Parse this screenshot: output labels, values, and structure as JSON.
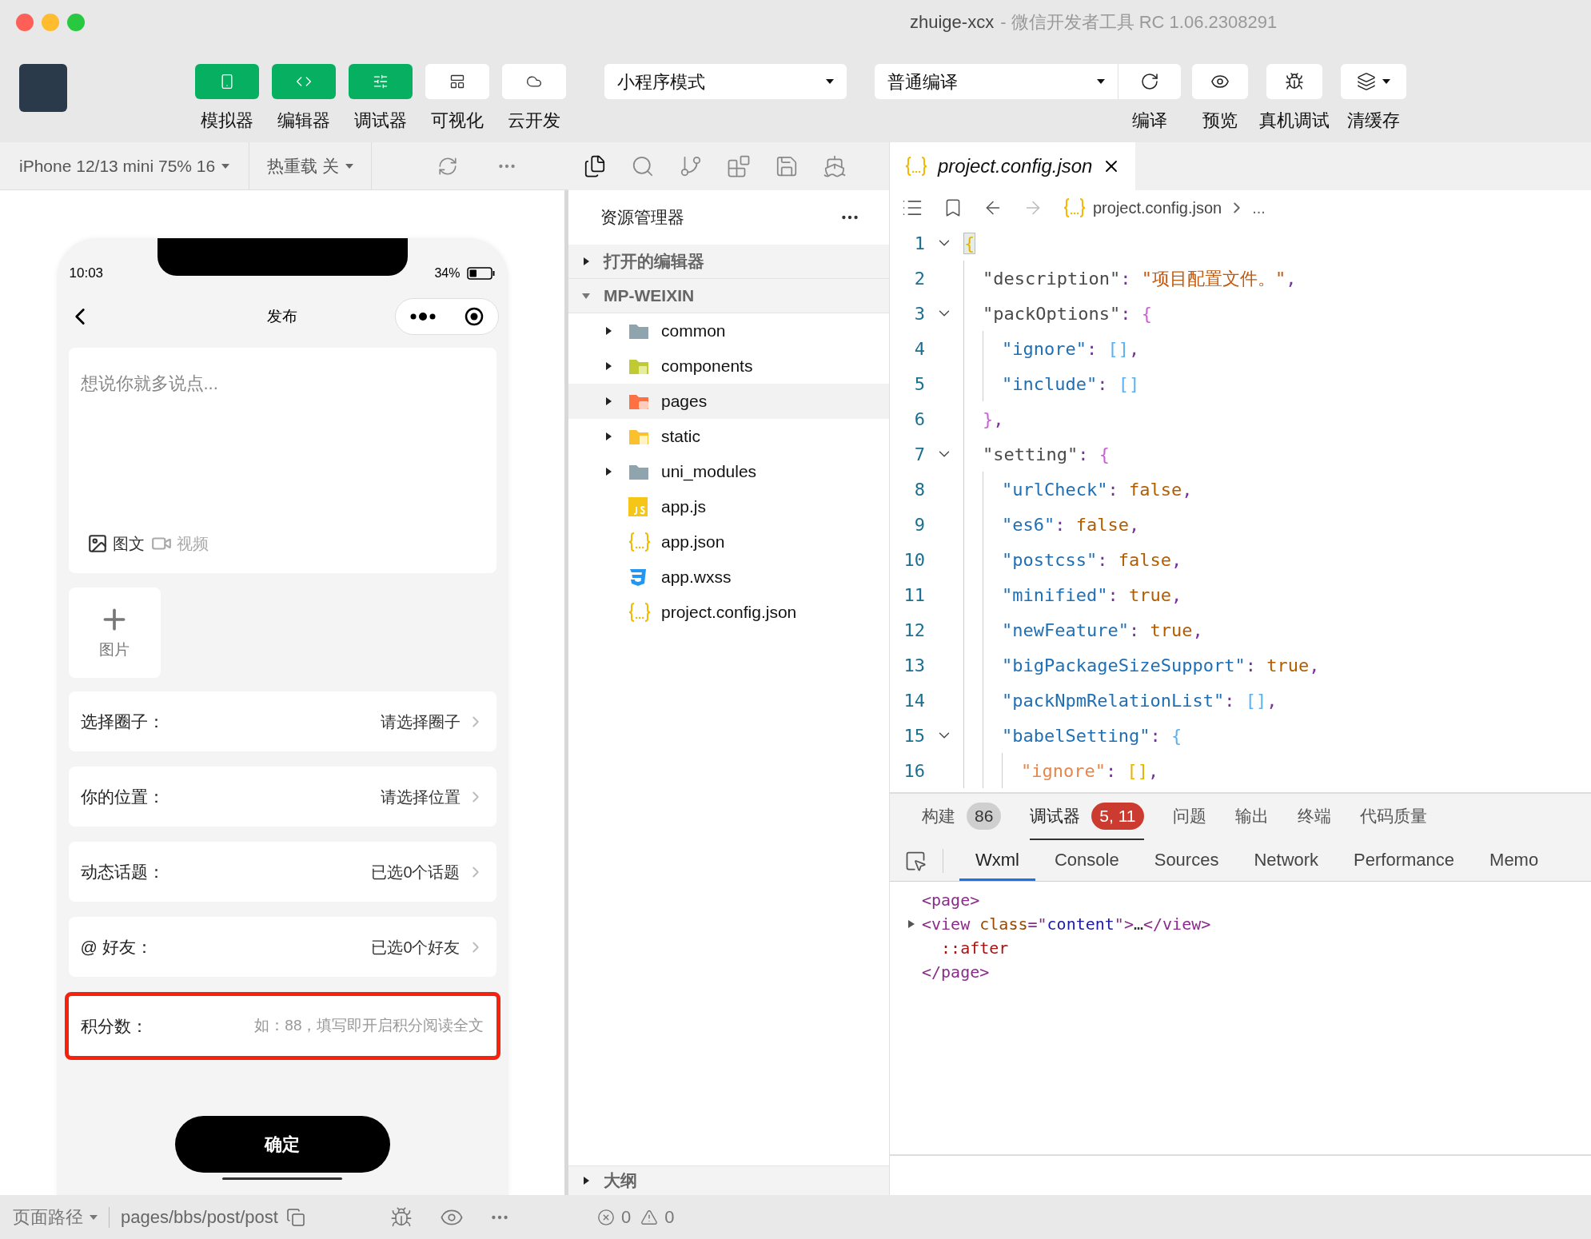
{
  "window": {
    "title": "zhuige-xcx",
    "subtitle": "- 微信开发者工具 RC 1.06.2308291"
  },
  "toolbar": {
    "view_toggles": [
      {
        "label": "模拟器",
        "kind": "phone",
        "on": true
      },
      {
        "label": "编辑器",
        "kind": "code",
        "on": true
      },
      {
        "label": "调试器",
        "kind": "sliders",
        "on": true
      },
      {
        "label": "可视化",
        "kind": "layout",
        "on": false
      },
      {
        "label": "云开发",
        "kind": "cloud",
        "on": false
      }
    ],
    "mode_select": "小程序模式",
    "compile_select": "普通编译",
    "actions": [
      {
        "label": "编译",
        "kind": "refresh"
      },
      {
        "label": "预览",
        "kind": "eye"
      },
      {
        "label": "真机调试",
        "kind": "bug"
      },
      {
        "label": "清缓存",
        "kind": "layers"
      }
    ]
  },
  "simulator": {
    "device": "iPhone 12/13 mini 75% 16",
    "hot_reload": "热重载 关",
    "phone": {
      "time": "10:03",
      "battery": {
        "text": "34%",
        "level": 0.34
      },
      "nav_title": "发布",
      "editor_placeholder": "想说你就多说点...",
      "media_types": [
        {
          "label": "图文",
          "kind": "image",
          "selected": true
        },
        {
          "label": "视频",
          "kind": "video",
          "selected": false
        }
      ],
      "add_image": "图片",
      "rows": [
        {
          "kind": "picker",
          "label": "选择圈子：",
          "value": "请选择圈子",
          "highlighted": false
        },
        {
          "kind": "picker",
          "label": "你的位置：",
          "value": "请选择位置",
          "highlighted": false
        },
        {
          "kind": "picker",
          "label": "动态话题：",
          "value": "已选0个话题",
          "highlighted": false
        },
        {
          "kind": "picker",
          "label": "@ 好友：",
          "value": "已选0个好友",
          "highlighted": false
        },
        {
          "kind": "input",
          "label": "积分数：",
          "placeholder": "如：88，填写即开启积分阅读全文",
          "highlighted": true
        }
      ],
      "submit": "确定"
    },
    "page_path": {
      "label": "页面路径",
      "path": "pages/bbs/post/post"
    }
  },
  "explorer": {
    "title": "资源管理器",
    "sections": [
      {
        "title": "打开的编辑器",
        "expanded": false
      },
      {
        "title": "MP-WEIXIN",
        "expanded": true,
        "children": [
          {
            "name": "common",
            "kind": "folder",
            "expanded": false,
            "selected": false
          },
          {
            "name": "components",
            "kind": "folder_components",
            "expanded": false,
            "selected": false
          },
          {
            "name": "pages",
            "kind": "folder_pages",
            "expanded": false,
            "selected": true
          },
          {
            "name": "static",
            "kind": "folder_static",
            "expanded": false,
            "selected": false
          },
          {
            "name": "uni_modules",
            "kind": "folder",
            "expanded": false,
            "selected": false
          },
          {
            "name": "app.js",
            "kind": "js",
            "selected": false
          },
          {
            "name": "app.json",
            "kind": "json",
            "selected": false
          },
          {
            "name": "app.wxss",
            "kind": "css",
            "selected": false
          },
          {
            "name": "project.config.json",
            "kind": "json",
            "selected": false
          }
        ]
      }
    ],
    "outline": {
      "title": "大纲",
      "expanded": false
    },
    "status": {
      "errors": "0",
      "warnings": "0"
    }
  },
  "editor": {
    "tab": "project.config.json",
    "breadcrumb": "project.config.json",
    "breadcrumb_more": "...",
    "lines": [
      {
        "number": "1",
        "fold": true,
        "tokens": [
          {
            "kind": "bracket3",
            "text": "{"
          }
        ]
      },
      {
        "number": "2",
        "fold": false,
        "tokens": [
          {
            "kind": "key1",
            "text": "\"description\""
          },
          {
            "kind": "punct",
            "text": ": "
          },
          {
            "kind": "string",
            "text": "\"项目配置文件。\""
          },
          {
            "kind": "punct",
            "text": ","
          }
        ]
      },
      {
        "number": "3",
        "fold": true,
        "tokens": [
          {
            "kind": "key1",
            "text": "\"packOptions\""
          },
          {
            "kind": "punct",
            "text": ": "
          },
          {
            "kind": "bracket1",
            "text": "{"
          }
        ]
      },
      {
        "number": "4",
        "fold": false,
        "tokens": [
          {
            "kind": "key2",
            "text": "\"ignore\""
          },
          {
            "kind": "punct",
            "text": ": "
          },
          {
            "kind": "bracket2",
            "text": "[]"
          },
          {
            "kind": "punct",
            "text": ","
          }
        ]
      },
      {
        "number": "5",
        "fold": false,
        "tokens": [
          {
            "kind": "key2",
            "text": "\"include\""
          },
          {
            "kind": "punct",
            "text": ": "
          },
          {
            "kind": "bracket2",
            "text": "[]"
          }
        ]
      },
      {
        "number": "6",
        "fold": false,
        "tokens": [
          {
            "kind": "bracket1",
            "text": "}"
          },
          {
            "kind": "punct",
            "text": ","
          }
        ]
      },
      {
        "number": "7",
        "fold": true,
        "tokens": [
          {
            "kind": "key1",
            "text": "\"setting\""
          },
          {
            "kind": "punct",
            "text": ": "
          },
          {
            "kind": "bracket1",
            "text": "{"
          }
        ]
      },
      {
        "number": "8",
        "fold": false,
        "tokens": [
          {
            "kind": "key2",
            "text": "\"urlCheck\""
          },
          {
            "kind": "punct",
            "text": ": "
          },
          {
            "kind": "literal",
            "text": "false"
          },
          {
            "kind": "punct",
            "text": ","
          }
        ]
      },
      {
        "number": "9",
        "fold": false,
        "tokens": [
          {
            "kind": "key2",
            "text": "\"es6\""
          },
          {
            "kind": "punct",
            "text": ": "
          },
          {
            "kind": "literal",
            "text": "false"
          },
          {
            "kind": "punct",
            "text": ","
          }
        ]
      },
      {
        "number": "10",
        "fold": false,
        "tokens": [
          {
            "kind": "key2",
            "text": "\"postcss\""
          },
          {
            "kind": "punct",
            "text": ": "
          },
          {
            "kind": "literal",
            "text": "false"
          },
          {
            "kind": "punct",
            "text": ","
          }
        ]
      },
      {
        "number": "11",
        "fold": false,
        "tokens": [
          {
            "kind": "key2",
            "text": "\"minified\""
          },
          {
            "kind": "punct",
            "text": ": "
          },
          {
            "kind": "literal",
            "text": "true"
          },
          {
            "kind": "punct",
            "text": ","
          }
        ]
      },
      {
        "number": "12",
        "fold": false,
        "tokens": [
          {
            "kind": "key2",
            "text": "\"newFeature\""
          },
          {
            "kind": "punct",
            "text": ": "
          },
          {
            "kind": "literal",
            "text": "true"
          },
          {
            "kind": "punct",
            "text": ","
          }
        ]
      },
      {
        "number": "13",
        "fold": false,
        "tokens": [
          {
            "kind": "key2",
            "text": "\"bigPackageSizeSupport\""
          },
          {
            "kind": "punct",
            "text": ": "
          },
          {
            "kind": "literal",
            "text": "true"
          },
          {
            "kind": "punct",
            "text": ","
          }
        ]
      },
      {
        "number": "14",
        "fold": false,
        "tokens": [
          {
            "kind": "key2",
            "text": "\"packNpmRelationList\""
          },
          {
            "kind": "punct",
            "text": ": "
          },
          {
            "kind": "bracket2",
            "text": "[]"
          },
          {
            "kind": "punct",
            "text": ","
          }
        ]
      },
      {
        "number": "15",
        "fold": true,
        "tokens": [
          {
            "kind": "key2",
            "text": "\"babelSetting\""
          },
          {
            "kind": "punct",
            "text": ": "
          },
          {
            "kind": "bracket2",
            "text": "{"
          }
        ]
      },
      {
        "number": "16",
        "fold": false,
        "tokens": [
          {
            "kind": "key3",
            "text": "\"ignore\""
          },
          {
            "kind": "punct",
            "text": ": "
          },
          {
            "kind": "bracket3",
            "text": "[]"
          },
          {
            "kind": "punct",
            "text": ","
          }
        ]
      }
    ]
  },
  "panel": {
    "tabs": [
      {
        "label": "构建",
        "badge": "86",
        "color": "#cfcfcf",
        "selected": false
      },
      {
        "label": "调试器",
        "badge": "5, 11",
        "color": "#cc3b30",
        "selected": true
      },
      {
        "label": "问题",
        "selected": false
      },
      {
        "label": "输出",
        "selected": false
      },
      {
        "label": "终端",
        "selected": false
      },
      {
        "label": "代码质量",
        "selected": false
      }
    ],
    "devtools_tabs": [
      {
        "label": "Wxml",
        "selected": true
      },
      {
        "label": "Console",
        "selected": false
      },
      {
        "label": "Sources",
        "selected": false
      },
      {
        "label": "Network",
        "selected": false
      },
      {
        "label": "Performance",
        "selected": false
      },
      {
        "label": "Memo",
        "selected": false
      }
    ],
    "wxml_lines": [
      {
        "expander": false,
        "tokens": [
          {
            "kind": "tag",
            "text": "<page>"
          }
        ]
      },
      {
        "expander": true,
        "tokens": [
          {
            "kind": "tag",
            "text": "<view"
          },
          {
            "kind": "attr",
            "text": " class"
          },
          {
            "kind": "tag",
            "text": "=\""
          },
          {
            "kind": "value",
            "text": "content"
          },
          {
            "kind": "tag",
            "text": "\">"
          },
          {
            "kind": "plain",
            "text": "…"
          },
          {
            "kind": "tag",
            "text": "</view>"
          }
        ]
      },
      {
        "expander": false,
        "tokens": [
          {
            "kind": "pseudo",
            "text": "  ::after"
          }
        ]
      },
      {
        "expander": false,
        "tokens": [
          {
            "kind": "tag",
            "text": "</page>"
          }
        ]
      }
    ]
  }
}
